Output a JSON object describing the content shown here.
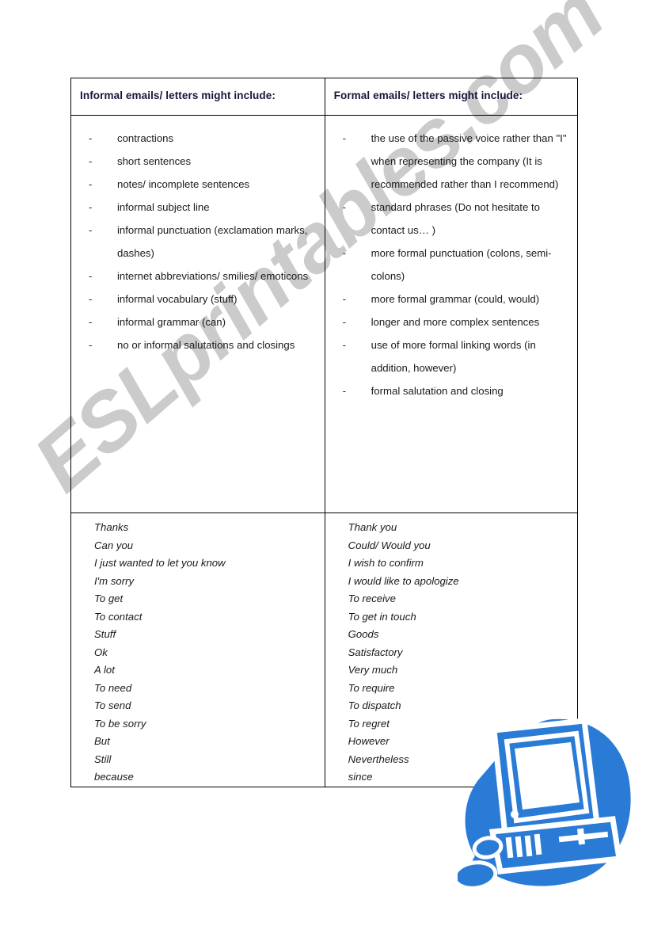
{
  "table": {
    "columns": [
      {
        "header": "Informal emails/ letters might include:",
        "bullets": [
          "contractions",
          "short sentences",
          "notes/ incomplete sentences",
          "informal subject line",
          "informal punctuation (exclamation marks, dashes)",
          "internet abbreviations/ smilies/ emoticons",
          "informal vocabulary (stuff)",
          "informal grammar (can)",
          "no or informal salutations and closings"
        ],
        "phrases": [
          "Thanks",
          "Can you",
          "I just wanted to let you know",
          "I'm sorry",
          "To get",
          "To contact",
          "Stuff",
          "Ok",
          "A lot",
          "To need",
          "To send",
          "To be sorry",
          "But",
          "Still",
          "because"
        ]
      },
      {
        "header": "Formal emails/ letters might include:",
        "bullets": [
          "the use of the passive voice rather than \"I\" when representing the company (It is recommended rather than I recommend)",
          "standard phrases (Do not hesitate to contact us… )",
          "more formal punctuation (colons, semi-colons)",
          "more formal grammar (could, would)",
          "longer and more complex sentences",
          "use of more formal linking words (in addition, however)",
          "formal salutation and closing"
        ],
        "phrases": [
          "Thank you",
          "Could/ Would you",
          "I wish to confirm",
          "I would like to apologize",
          "To receive",
          "To get in touch",
          "Goods",
          "Satisfactory",
          "Very much",
          "To require",
          "To dispatch",
          "To regret",
          "However",
          "Nevertheless",
          "since"
        ]
      }
    ],
    "bullet_marker": "-"
  },
  "watermark": {
    "text": "ESLprintables.com",
    "color": "#c9c9c9"
  },
  "clipart": {
    "name": "desktop-computer-clipart",
    "color": "#2a7bd6"
  },
  "colors": {
    "header_background": "#3355ee",
    "header_text": "#16163c",
    "body_text": "#1a1a1a",
    "border": "#000000",
    "page_background": "#ffffff"
  }
}
